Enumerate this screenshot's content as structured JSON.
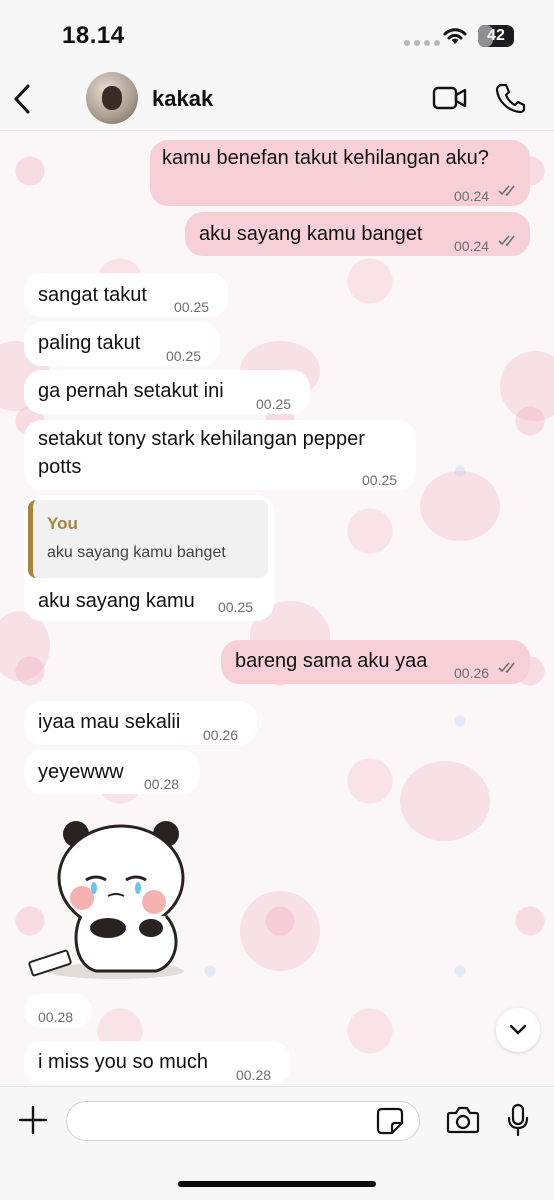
{
  "status_bar": {
    "time": "18.14",
    "battery": "42",
    "battery_level": 0.42
  },
  "header": {
    "contact_name": "kakak"
  },
  "messages": [
    {
      "dir": "out",
      "text": "kamu benefan takut kehilangan aku?",
      "time": "00.24",
      "read": true
    },
    {
      "dir": "out",
      "text": "aku sayang kamu banget",
      "time": "00.24",
      "read": true
    },
    {
      "dir": "in",
      "text": "sangat takut",
      "time": "00.25"
    },
    {
      "dir": "in",
      "text": "paling takut",
      "time": "00.25"
    },
    {
      "dir": "in",
      "text": "ga pernah setakut ini",
      "time": "00.25"
    },
    {
      "dir": "in",
      "text_line1": "setakut tony stark kehilangan pepper",
      "text_line2": "potts",
      "time": "00.25"
    },
    {
      "dir": "in",
      "reply_to": {
        "author": "You",
        "text": "aku sayang kamu banget"
      },
      "text": "aku sayang kamu",
      "time": "00.25"
    },
    {
      "dir": "out",
      "text": "bareng sama aku yaa",
      "time": "00.26",
      "read": true
    },
    {
      "dir": "in",
      "text": "iyaa mau sekalii",
      "time": "00.26"
    },
    {
      "dir": "in",
      "text": "yeyewww",
      "time": "00.28"
    },
    {
      "dir": "in",
      "type": "sticker",
      "sticker": "crying-panda",
      "time": "00.28"
    },
    {
      "dir": "in",
      "text": "i miss you so much",
      "time": "00.28"
    }
  ],
  "composer": {
    "placeholder": ""
  },
  "colors": {
    "outgoing_bubble": "#f7cfd7",
    "incoming_bubble": "#ffffff",
    "quote_accent": "#a88440",
    "read_ticks": "#6e6e6e"
  },
  "icons": [
    "back-chevron-icon",
    "video-call-icon",
    "phone-icon",
    "plus-icon",
    "sticker-icon",
    "camera-icon",
    "microphone-icon",
    "chevron-down-icon",
    "double-check-icon",
    "wifi-icon"
  ]
}
